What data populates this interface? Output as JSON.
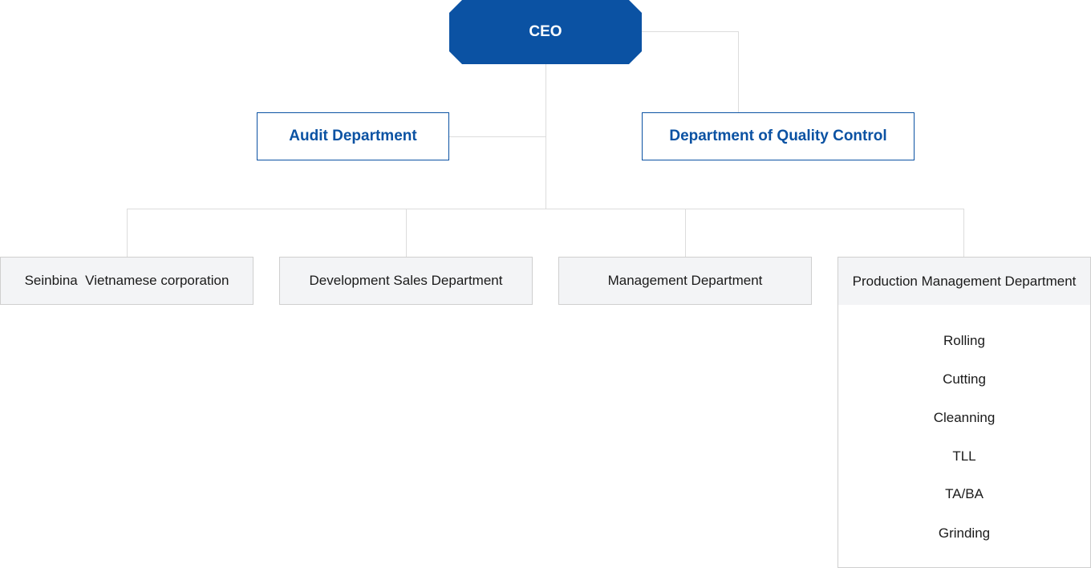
{
  "chart": {
    "ceo": "CEO",
    "staff": {
      "audit": "Audit Department",
      "quality": "Department of Quality Control"
    },
    "departments": [
      "Seinbina  Vietnamese corporation",
      "Development Sales Department",
      "Management Department"
    ],
    "production": {
      "title": "Production Management Department",
      "units": [
        "Rolling",
        "Cutting",
        "Cleanning",
        "TLL",
        "TA/BA",
        "Grinding"
      ]
    }
  },
  "colors": {
    "primary": "#0b52a3",
    "box_fill": "#f3f4f6",
    "border": "#cfcfcf",
    "connector": "#dcdcdc"
  }
}
